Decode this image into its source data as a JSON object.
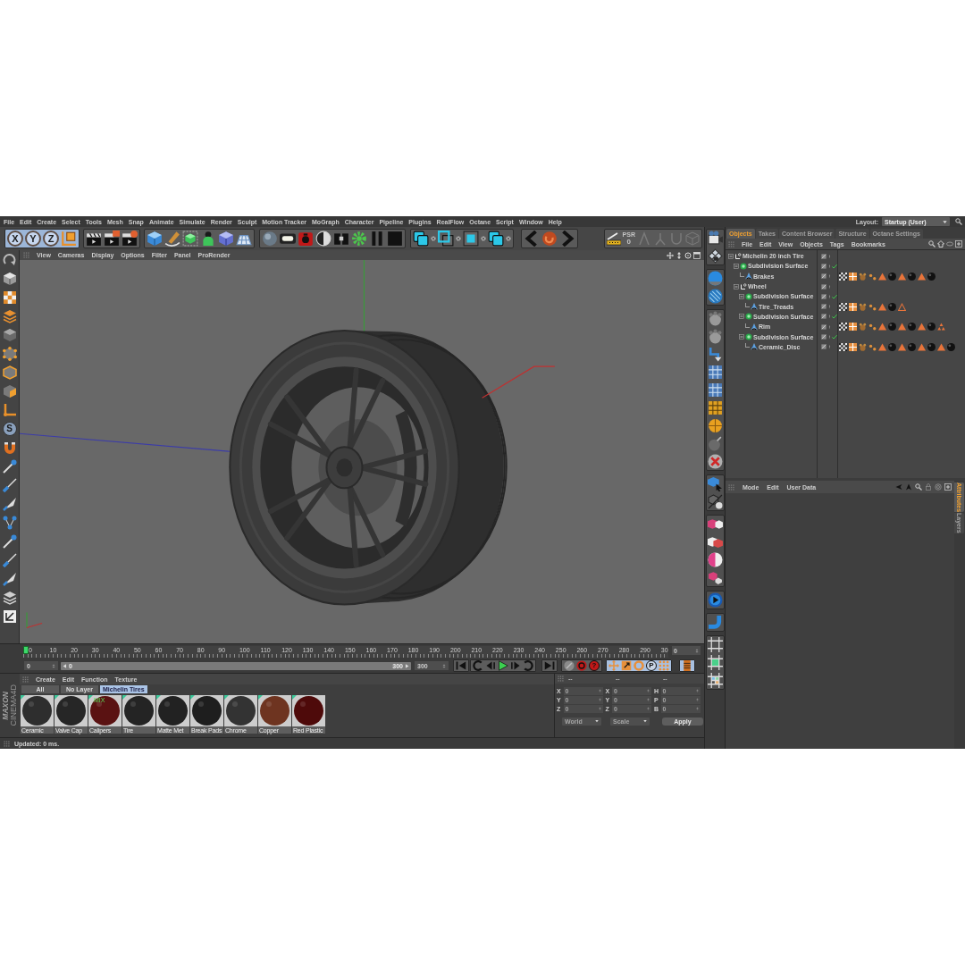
{
  "menu_bar": {
    "items": [
      "File",
      "Edit",
      "Create",
      "Select",
      "Tools",
      "Mesh",
      "Snap",
      "Animate",
      "Simulate",
      "Render",
      "Sculpt",
      "Motion Tracker",
      "MoGraph",
      "Character",
      "Pipeline",
      "Plugins",
      "RealFlow",
      "Octane",
      "Script",
      "Window",
      "Help"
    ],
    "layout_label": "Layout:",
    "layout_value": "Startup (User)"
  },
  "toolbar": {
    "axis_buttons": [
      {
        "label": "X",
        "on": true
      },
      {
        "label": "Y",
        "on": true
      },
      {
        "label": "Z",
        "on": true
      }
    ],
    "snap_label": "PSR",
    "snap_value": "0"
  },
  "left_toolbar": {
    "solo_label": "S"
  },
  "viewport": {
    "menu": [
      "View",
      "Cameras",
      "Display",
      "Options",
      "Filter",
      "Panel",
      "ProRender"
    ]
  },
  "object_manager": {
    "tabs": [
      {
        "label": "Objects",
        "selected": true
      },
      {
        "label": "Takes",
        "selected": false
      },
      {
        "label": "Content Browser",
        "selected": false
      },
      {
        "label": "Structure",
        "selected": false
      },
      {
        "label": "Octane Settings",
        "selected": false
      }
    ],
    "menu": [
      "File",
      "Edit",
      "View",
      "Objects",
      "Tags",
      "Bookmarks"
    ],
    "tree": [
      {
        "name": "Michelin 20 inch Tire",
        "kind": "null",
        "expanded": true,
        "children": [
          {
            "name": "Subdivision Surface",
            "kind": "subdivision",
            "enabled": true,
            "expanded": true,
            "children": [
              {
                "name": "Brakes",
                "kind": "polygon",
                "tags": [
                  {
                    "kind": "texture"
                  },
                  {
                    "kind": "uvw"
                  },
                  {
                    "kind": "phong"
                  },
                  {
                    "kind": "points"
                  },
                  {
                    "kind": "selection"
                  },
                  {
                    "kind": "material"
                  },
                  {
                    "kind": "selection"
                  },
                  {
                    "kind": "material"
                  },
                  {
                    "kind": "selection"
                  },
                  {
                    "kind": "material"
                  }
                ]
              }
            ]
          },
          {
            "name": "Wheel",
            "kind": "null",
            "expanded": true,
            "children": [
              {
                "name": "Subdivision Surface",
                "kind": "subdivision",
                "enabled": true,
                "expanded": true,
                "children": [
                  {
                    "name": "Tire_Treads",
                    "kind": "polygon",
                    "tags": [
                      {
                        "kind": "texture"
                      },
                      {
                        "kind": "uvw"
                      },
                      {
                        "kind": "phong"
                      },
                      {
                        "kind": "points"
                      },
                      {
                        "kind": "selection"
                      },
                      {
                        "kind": "material"
                      },
                      {
                        "kind": "outline"
                      }
                    ]
                  }
                ]
              },
              {
                "name": "Subdivision Surface",
                "kind": "subdivision",
                "enabled": true,
                "expanded": true,
                "children": [
                  {
                    "name": "Rim",
                    "kind": "polygon",
                    "tags": [
                      {
                        "kind": "texture"
                      },
                      {
                        "kind": "uvw"
                      },
                      {
                        "kind": "phong"
                      },
                      {
                        "kind": "points"
                      },
                      {
                        "kind": "selection"
                      },
                      {
                        "kind": "material"
                      },
                      {
                        "kind": "selection"
                      },
                      {
                        "kind": "material"
                      },
                      {
                        "kind": "selection"
                      },
                      {
                        "kind": "material"
                      },
                      {
                        "kind": "cluster"
                      }
                    ]
                  }
                ]
              },
              {
                "name": "Subdivision Surface",
                "kind": "subdivision",
                "enabled": true,
                "expanded": true,
                "children": [
                  {
                    "name": "Ceramic_Disc",
                    "kind": "polygon",
                    "tags": [
                      {
                        "kind": "texture"
                      },
                      {
                        "kind": "uvw"
                      },
                      {
                        "kind": "phong"
                      },
                      {
                        "kind": "points"
                      },
                      {
                        "kind": "selection"
                      },
                      {
                        "kind": "material"
                      },
                      {
                        "kind": "selection"
                      },
                      {
                        "kind": "material"
                      },
                      {
                        "kind": "selection"
                      },
                      {
                        "kind": "material"
                      },
                      {
                        "kind": "selection"
                      },
                      {
                        "kind": "material"
                      }
                    ]
                  }
                ]
              }
            ]
          }
        ]
      }
    ]
  },
  "attribute_manager": {
    "menu": [
      "Mode",
      "Edit",
      "User Data"
    ],
    "side_tabs": [
      {
        "label": "Attributes",
        "selected": true
      },
      {
        "label": "Layers",
        "selected": false
      }
    ]
  },
  "timeline": {
    "ticks": [
      "0",
      "10",
      "20",
      "30",
      "40",
      "50",
      "60",
      "70",
      "80",
      "90",
      "100",
      "110",
      "120",
      "130",
      "140",
      "150",
      "160",
      "170",
      "180",
      "190",
      "200",
      "210",
      "220",
      "230",
      "240",
      "250",
      "260",
      "270",
      "280",
      "290",
      "30"
    ],
    "playhead": {
      "level": 0
    },
    "frame_field": "0",
    "start_field": "0",
    "range": {
      "start": "0",
      "end": "300",
      "level": 1
    },
    "end_field": "300",
    "help_label": "?",
    "parameter_label": "P"
  },
  "material_manager": {
    "menu": [
      "Create",
      "Edit",
      "Function",
      "Texture"
    ],
    "filters": [
      {
        "label": "All",
        "selected": false
      },
      {
        "label": "No Layer",
        "selected": false
      },
      {
        "label": "Michelin Tires",
        "selected": true
      }
    ],
    "materials": [
      {
        "name": "Ceramic",
        "color": "#2e2e2e"
      },
      {
        "name": "Valve Cap",
        "color": "#262626"
      },
      {
        "name": "Calipers",
        "color": "#5a1212",
        "label": "MIX"
      },
      {
        "name": "Tire",
        "color": "#242424"
      },
      {
        "name": "Matte Met",
        "color": "#222222"
      },
      {
        "name": "Break Pads",
        "color": "#1e1e1e"
      },
      {
        "name": "Chrome",
        "color": "#333333"
      },
      {
        "name": "Copper",
        "color": "#6e3420"
      },
      {
        "name": "Red Plastic",
        "color": "#4e0a0a"
      }
    ]
  },
  "coordinates": {
    "headers": [
      "--",
      "--",
      "--"
    ],
    "rows": [
      {
        "labels": [
          "X",
          "X",
          "H"
        ],
        "values": [
          "0",
          "0",
          "0"
        ]
      },
      {
        "labels": [
          "Y",
          "Y",
          "P"
        ],
        "values": [
          "0",
          "0",
          "0"
        ]
      },
      {
        "labels": [
          "Z",
          "Z",
          "B"
        ],
        "values": [
          "0",
          "0",
          "0"
        ]
      }
    ],
    "dropdowns": [
      {
        "label": "World",
        "disabled": true
      },
      {
        "label": "Scale",
        "disabled": true
      }
    ],
    "apply": "Apply"
  },
  "logo": {
    "lines": [
      "MAXON",
      "CINEMA4D"
    ]
  },
  "status_bar": {
    "text": "Updated: 0 ms."
  }
}
